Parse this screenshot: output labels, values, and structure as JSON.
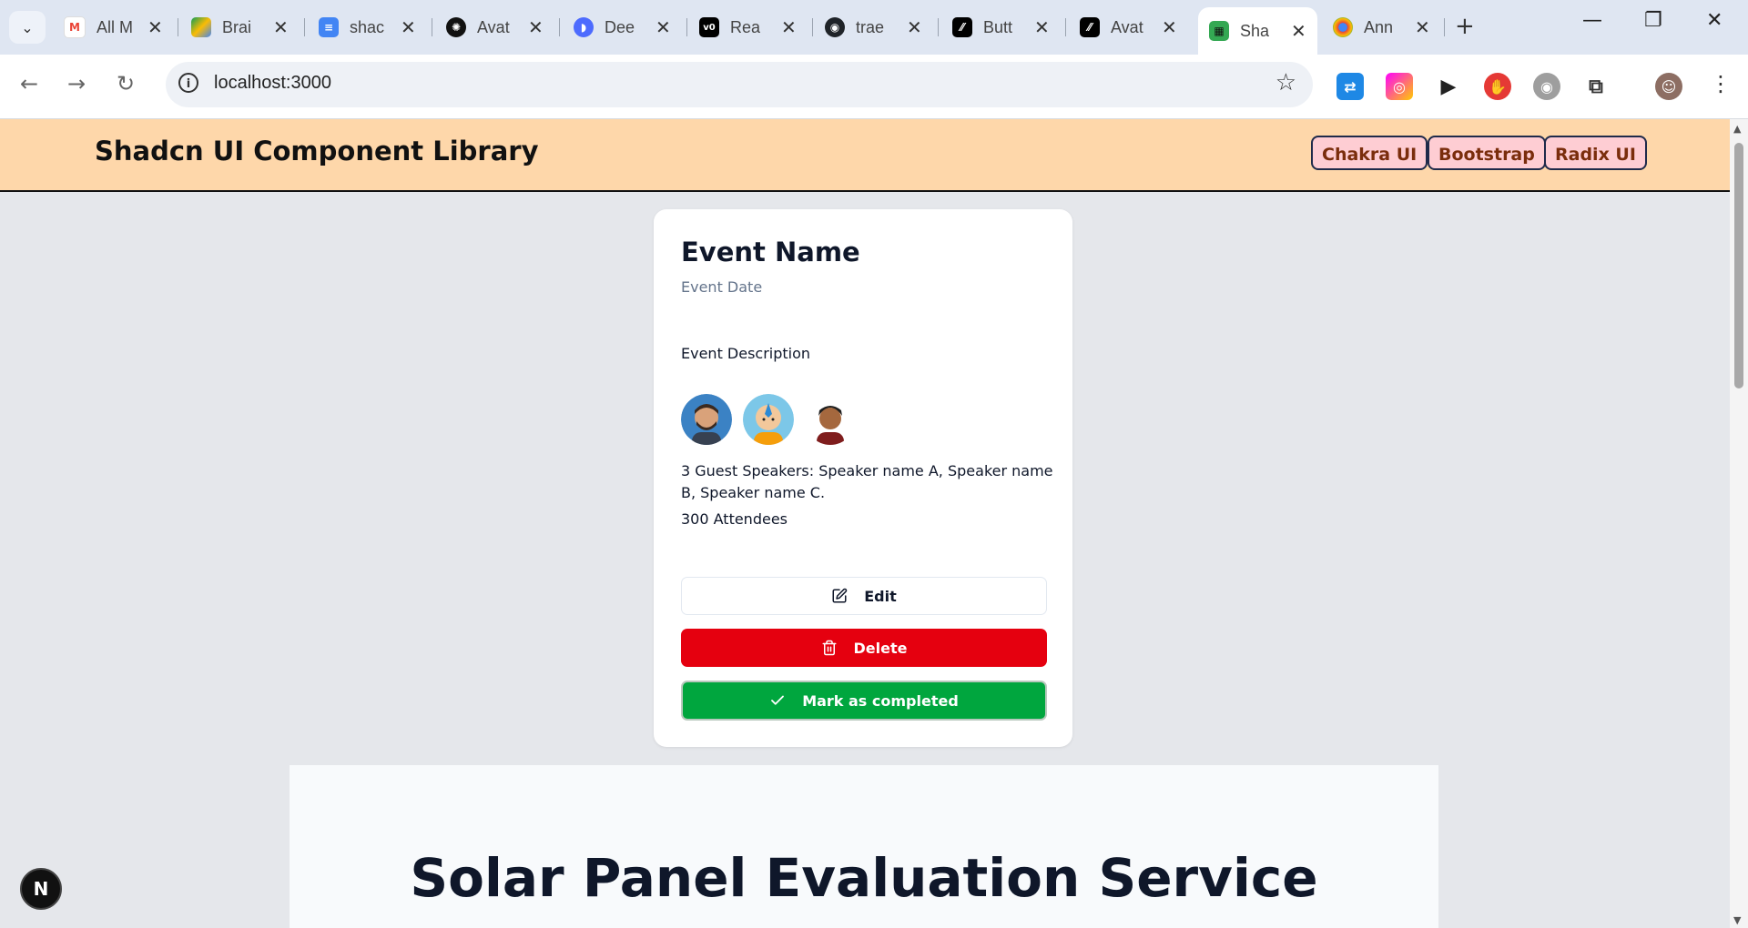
{
  "browser": {
    "tabs": [
      {
        "title": "All M",
        "icon": "gmail-icon"
      },
      {
        "title": "Brai",
        "icon": "google-drive-icon"
      },
      {
        "title": "shac",
        "icon": "google-docs-icon"
      },
      {
        "title": "Avat",
        "icon": "openai-icon"
      },
      {
        "title": "Dee",
        "icon": "deepseek-icon"
      },
      {
        "title": "Rea",
        "icon": "v0-icon"
      },
      {
        "title": "trae",
        "icon": "github-icon"
      },
      {
        "title": "Butt",
        "icon": "shadcn-icon"
      },
      {
        "title": "Avat",
        "icon": "shadcn-icon"
      },
      {
        "title": "Sha",
        "icon": "site-icon",
        "active": true
      },
      {
        "title": "Ann",
        "icon": "chrome-icon"
      }
    ],
    "url": "localhost:3000"
  },
  "header": {
    "brand": "Shadcn UI Component Library",
    "nav": [
      "Chakra UI",
      "Bootstrap",
      "Radix UI"
    ]
  },
  "event_card": {
    "title": "Event Name",
    "date": "Event Date",
    "description": "Event Description",
    "speakers": "3 Guest Speakers: Speaker name A, Speaker name B, Speaker name C.",
    "attendees": "300 Attendees",
    "buttons": {
      "edit": "Edit",
      "delete": "Delete",
      "complete": "Mark as completed"
    }
  },
  "solar_section": {
    "heading": "Solar Panel Evaluation Service"
  },
  "next_badge": "N",
  "colors": {
    "header_bg": "#fed7aa",
    "nav_bg": "#fecdd3",
    "delete": "#e5000f",
    "complete": "#00a63e"
  }
}
